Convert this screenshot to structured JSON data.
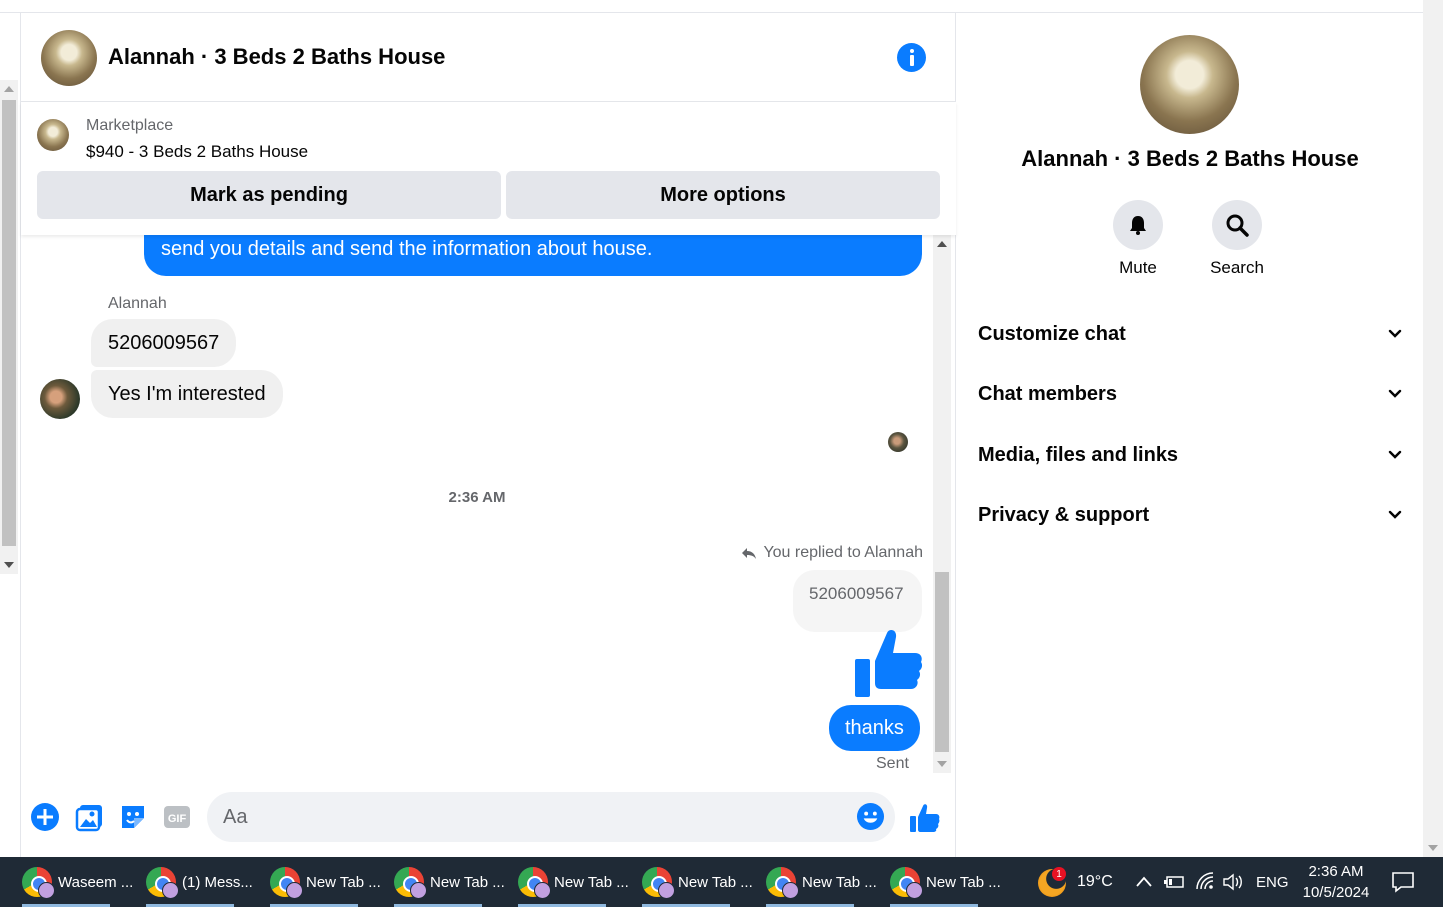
{
  "chat": {
    "title": "Alannah · 3 Beds 2 Baths House",
    "listing": {
      "source": "Marketplace",
      "price_title": "$940 - 3 Beds 2 Baths House",
      "mark_pending_label": "Mark as pending",
      "more_options_label": "More options"
    },
    "messages": {
      "outgoing_partial": "send you details and send the information about house.",
      "sender_name": "Alannah",
      "incoming": [
        "5206009567",
        "Yes I'm interested"
      ],
      "timestamp": "2:36 AM",
      "reply_note": "You replied to Alannah",
      "quoted_text": "5206009567",
      "thanks": "thanks",
      "status": "Sent"
    },
    "composer": {
      "placeholder": "Aa"
    }
  },
  "info_panel": {
    "name": "Alannah · 3 Beds 2 Baths House",
    "actions": [
      {
        "label": "Mute",
        "icon": "bell-icon"
      },
      {
        "label": "Search",
        "icon": "search-icon"
      }
    ],
    "sections": [
      "Customize chat",
      "Chat members",
      "Media, files and links",
      "Privacy & support"
    ]
  },
  "taskbar": {
    "tasks": [
      "Waseem ...",
      "(1) Mess...",
      "New Tab ...",
      "New Tab ...",
      "New Tab ...",
      "New Tab ...",
      "New Tab ...",
      "New Tab ..."
    ],
    "weather": {
      "temp": "19°C",
      "badge": "1"
    },
    "language": "ENG",
    "time": "2:36 AM",
    "date": "10/5/2024"
  },
  "colors": {
    "accent": "#0a7cff",
    "bubble_in": "#f0f0f0",
    "button_bg": "#e4e6eb",
    "taskbar_bg": "#1f2a36"
  }
}
